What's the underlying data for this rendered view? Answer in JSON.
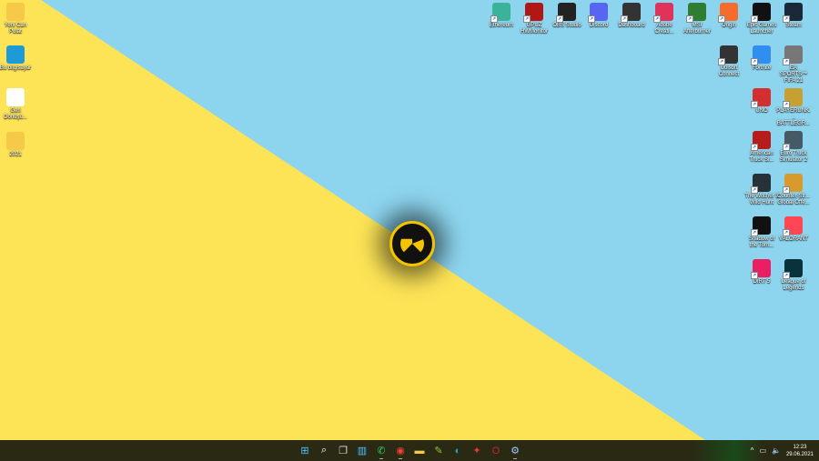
{
  "desktop": {
    "colors": {
      "yellow": "#FDE456",
      "blue": "#8DD5EE",
      "taskbar": "#2a2a14"
    },
    "left_icons": [
      {
        "label": "Yeni Can Pulat",
        "icon": "folder-icon",
        "color": "#F7C948"
      },
      {
        "label": "Bu bilgisayar",
        "icon": "monitor-icon",
        "color": "#1E9BD7"
      },
      {
        "label": "Geri Dönüşü...",
        "icon": "recycle-bin-icon",
        "color": "#ffffff"
      },
      {
        "label": "2021",
        "icon": "folder-icon",
        "color": "#F7C948"
      }
    ],
    "top_icons": [
      {
        "label": "Ethereum",
        "icon": "grid-icon",
        "color": "#3BB39A"
      },
      {
        "label": "GPUZ HWMonitor",
        "icon": "gpu-icon",
        "color": "#B31616"
      },
      {
        "label": "OBS Studio",
        "icon": "obs-icon",
        "color": "#222222"
      },
      {
        "label": "Discord",
        "icon": "discord-icon",
        "color": "#5865F2"
      },
      {
        "label": "Dashboard",
        "icon": "dashboard-icon",
        "color": "#333333"
      },
      {
        "label": "Adobe Creati...",
        "icon": "adobe-cc-icon",
        "color": "#E0335B"
      },
      {
        "label": "MSI Afterburner",
        "icon": "msi-icon",
        "color": "#2E7D32"
      },
      {
        "label": "Origin",
        "icon": "origin-icon",
        "color": "#F56C2D"
      },
      {
        "label": "Epic Games Launcher",
        "icon": "epic-icon",
        "color": "#111111"
      },
      {
        "label": "Steam",
        "icon": "steam-icon",
        "color": "#1B2838"
      }
    ],
    "right_icons": [
      {
        "label": "Ubisoft Connect",
        "icon": "ubisoft-icon",
        "color": "#333333"
      },
      {
        "label": "Fortnite",
        "icon": "fortnite-icon",
        "color": "#2F8EF0"
      },
      {
        "label": "EA SPORTS™ FIFA 21",
        "icon": "fifa-icon",
        "color": "#777777"
      },
      {
        "label": "UNO",
        "icon": "uno-icon",
        "color": "#D32F2F"
      },
      {
        "label": "PLAYERUNK... BATTLEGR...",
        "icon": "pubg-icon",
        "color": "#C8A032"
      },
      {
        "label": "American Truck Si...",
        "icon": "ats-icon",
        "color": "#B71C1C"
      },
      {
        "label": "Euro Truck Simulator 2",
        "icon": "ets2-icon",
        "color": "#455A64"
      },
      {
        "label": "The Witcher 3 Wild Hunt",
        "icon": "witcher-icon",
        "color": "#263238"
      },
      {
        "label": "Counter-Str... Global Offe...",
        "icon": "csgo-icon",
        "color": "#D89B2B"
      },
      {
        "label": "Shadow of the Tom...",
        "icon": "shadow-icon",
        "color": "#111111"
      },
      {
        "label": "VALORANT",
        "icon": "valorant-icon",
        "color": "#FF4655"
      },
      {
        "label": "DIRT 5",
        "icon": "dirt-icon",
        "color": "#E91E63"
      },
      {
        "label": "League of Legends",
        "icon": "lol-icon",
        "color": "#0A323C"
      }
    ]
  },
  "taskbar": {
    "apps": [
      {
        "name": "start-button",
        "glyph": "⊞",
        "color": "#4CC2FF"
      },
      {
        "name": "search-button",
        "glyph": "⌕",
        "color": "#ffffff"
      },
      {
        "name": "task-view-button",
        "glyph": "❐",
        "color": "#dddddd"
      },
      {
        "name": "widgets-button",
        "glyph": "▥",
        "color": "#4CC2FF"
      },
      {
        "name": "whatsapp-button",
        "glyph": "✆",
        "color": "#25D366"
      },
      {
        "name": "chrome-button",
        "glyph": "◉",
        "color": "#EA4335"
      },
      {
        "name": "file-explorer-button",
        "glyph": "▬",
        "color": "#F7C948"
      },
      {
        "name": "notepad-button",
        "glyph": "✎",
        "color": "#8BC34A"
      },
      {
        "name": "edge-button",
        "glyph": "◐",
        "color": "#1FA3E0"
      },
      {
        "name": "app-button",
        "glyph": "✦",
        "color": "#E53935"
      },
      {
        "name": "opera-button",
        "glyph": "O",
        "color": "#C62828"
      },
      {
        "name": "settings-button",
        "glyph": "⚙",
        "color": "#9FC5F8"
      }
    ],
    "tray": {
      "chevron": "^",
      "network": "▭",
      "volume": "🔈",
      "time": "12:23",
      "date": "29.06.2021"
    }
  }
}
